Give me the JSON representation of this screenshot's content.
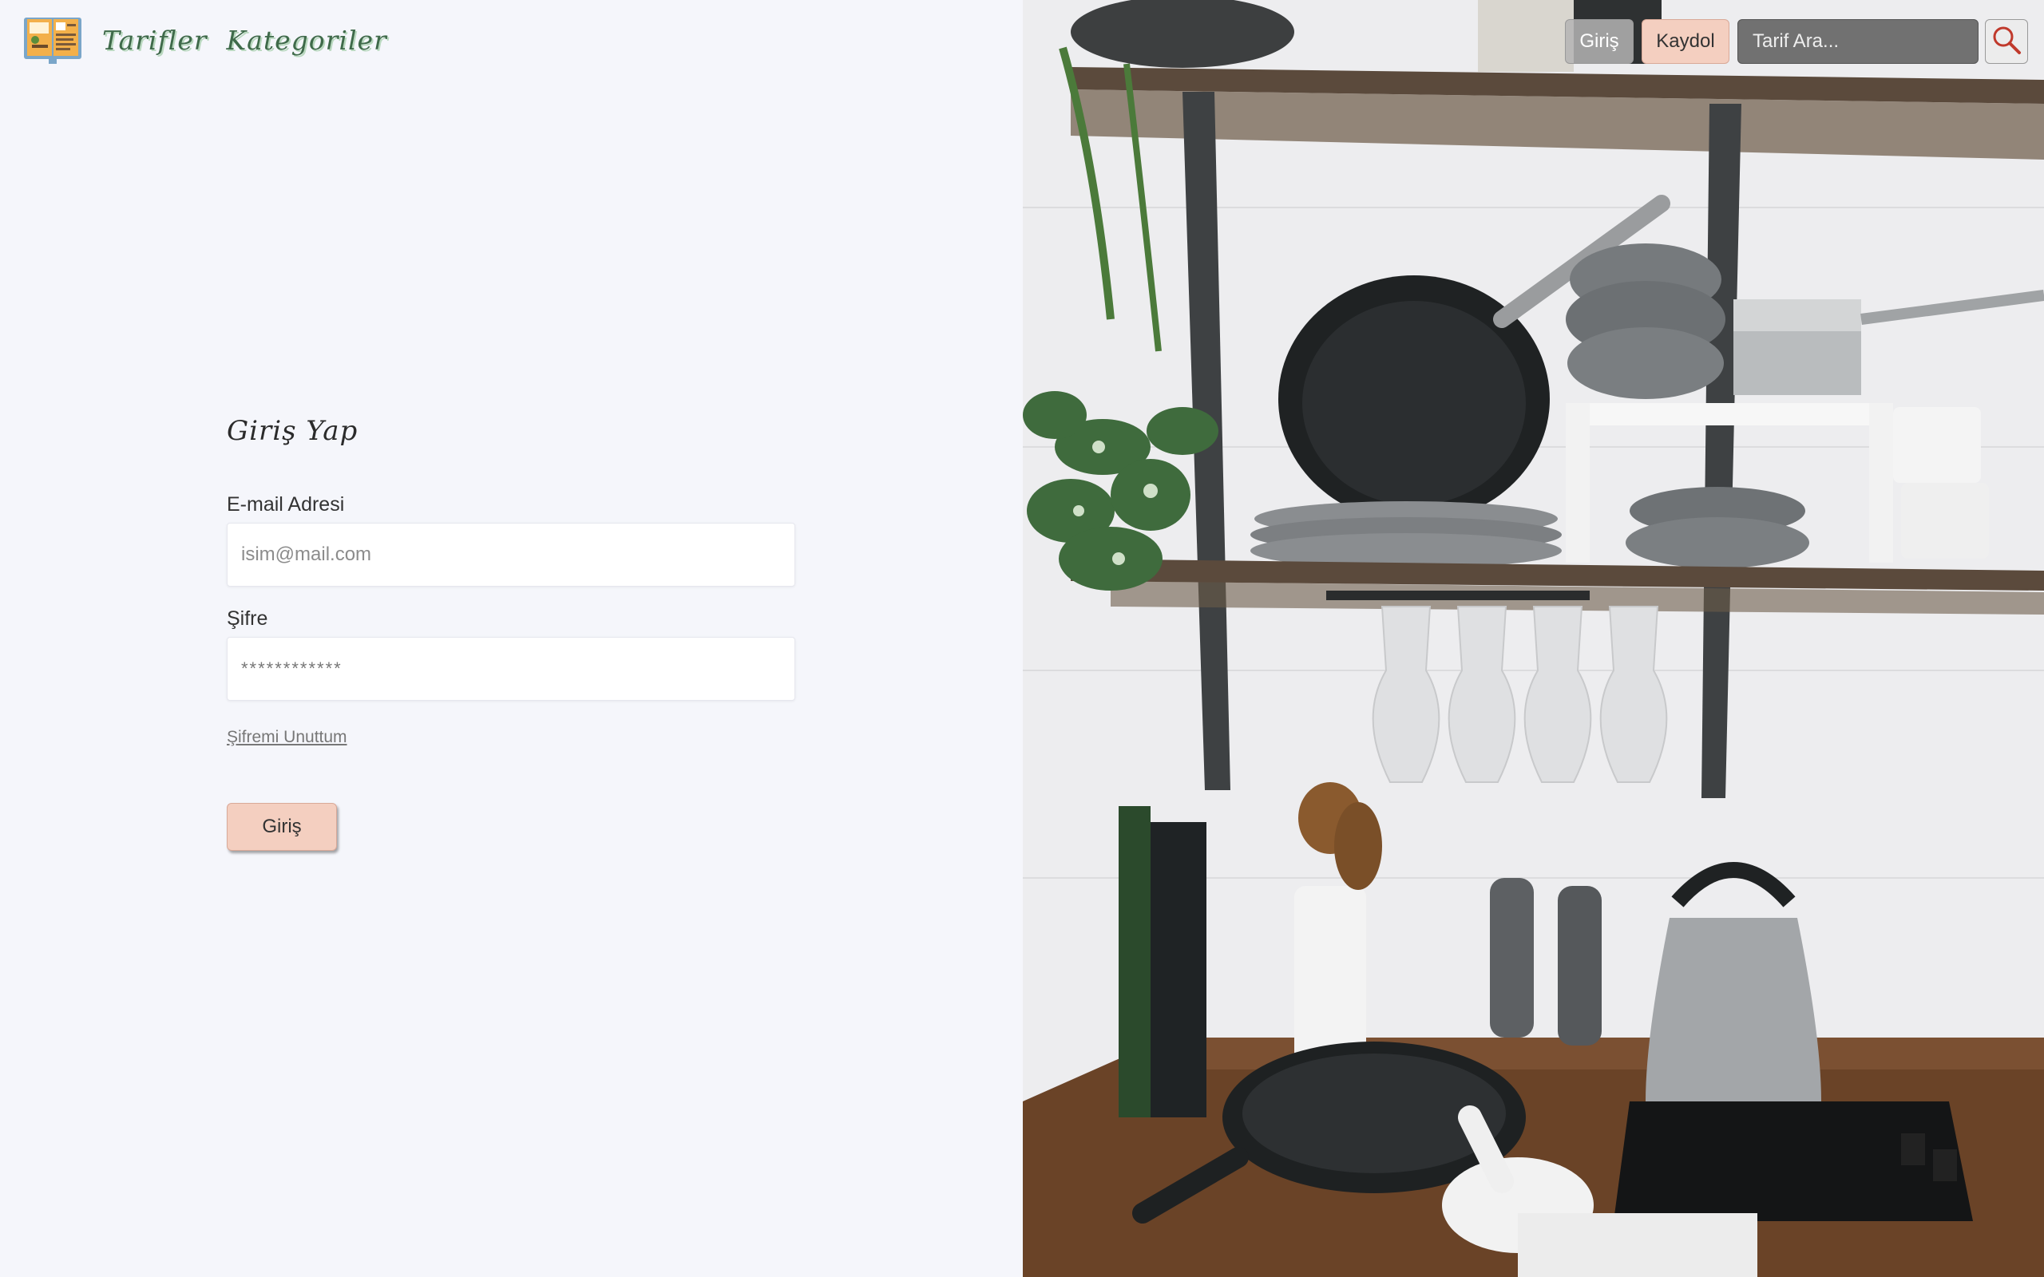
{
  "header": {
    "nav": [
      {
        "label": "Tarifler"
      },
      {
        "label": "Kategoriler"
      }
    ],
    "login_label": "Giriş",
    "register_label": "Kaydol",
    "search_placeholder": "Tarif Ara...",
    "icons": {
      "logo": "recipe-book-logo",
      "search": "search-icon"
    }
  },
  "login_form": {
    "title": "Giriş Yap",
    "email_label": "E-mail Adresi",
    "email_placeholder": "isim@mail.com",
    "password_label": "Şifre",
    "password_value": "************",
    "forgot_label": "Şifremi Unuttum",
    "submit_label": "Giriş"
  },
  "colors": {
    "background": "#f5f6fb",
    "accent_button": "#f4cfc0",
    "nav_text": "#3f6a4a"
  },
  "hero_image": {
    "subject": "kitchen shelves photo"
  }
}
